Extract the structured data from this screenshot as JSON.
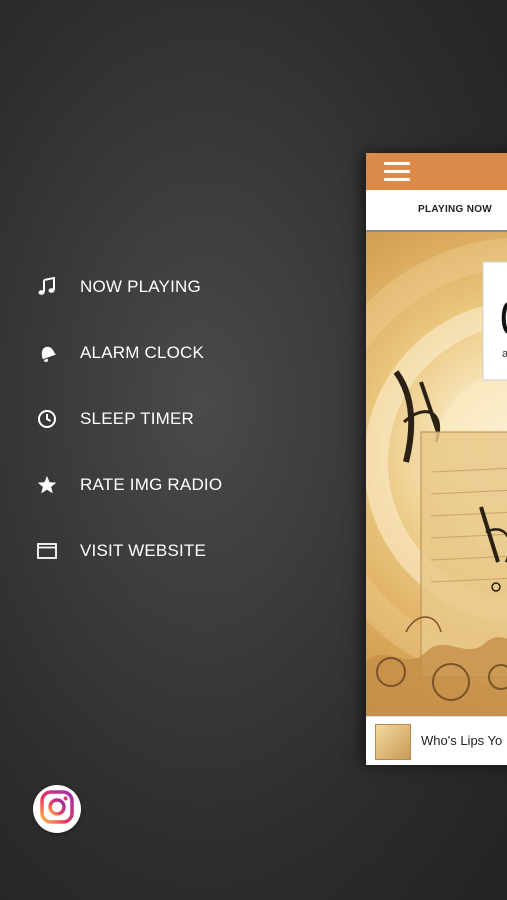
{
  "menu": {
    "items": [
      {
        "label": "NOW PLAYING",
        "icon": "music-note-icon"
      },
      {
        "label": "ALARM CLOCK",
        "icon": "bell-icon"
      },
      {
        "label": "SLEEP TIMER",
        "icon": "clock-icon"
      },
      {
        "label": "RATE IMG RADIO",
        "icon": "star-icon"
      },
      {
        "label": "VISIT WEBSITE",
        "icon": "browser-window-icon"
      }
    ]
  },
  "social": {
    "icon": "instagram-icon"
  },
  "app": {
    "header_color": "#dc8a4a",
    "tab_now": "PLAYING NOW",
    "now_playing_track": "Who's Lips Yo"
  },
  "colors": {
    "background": "#2e2e2e",
    "menu_text": "#ffffff",
    "accent": "#dc8a4a"
  }
}
